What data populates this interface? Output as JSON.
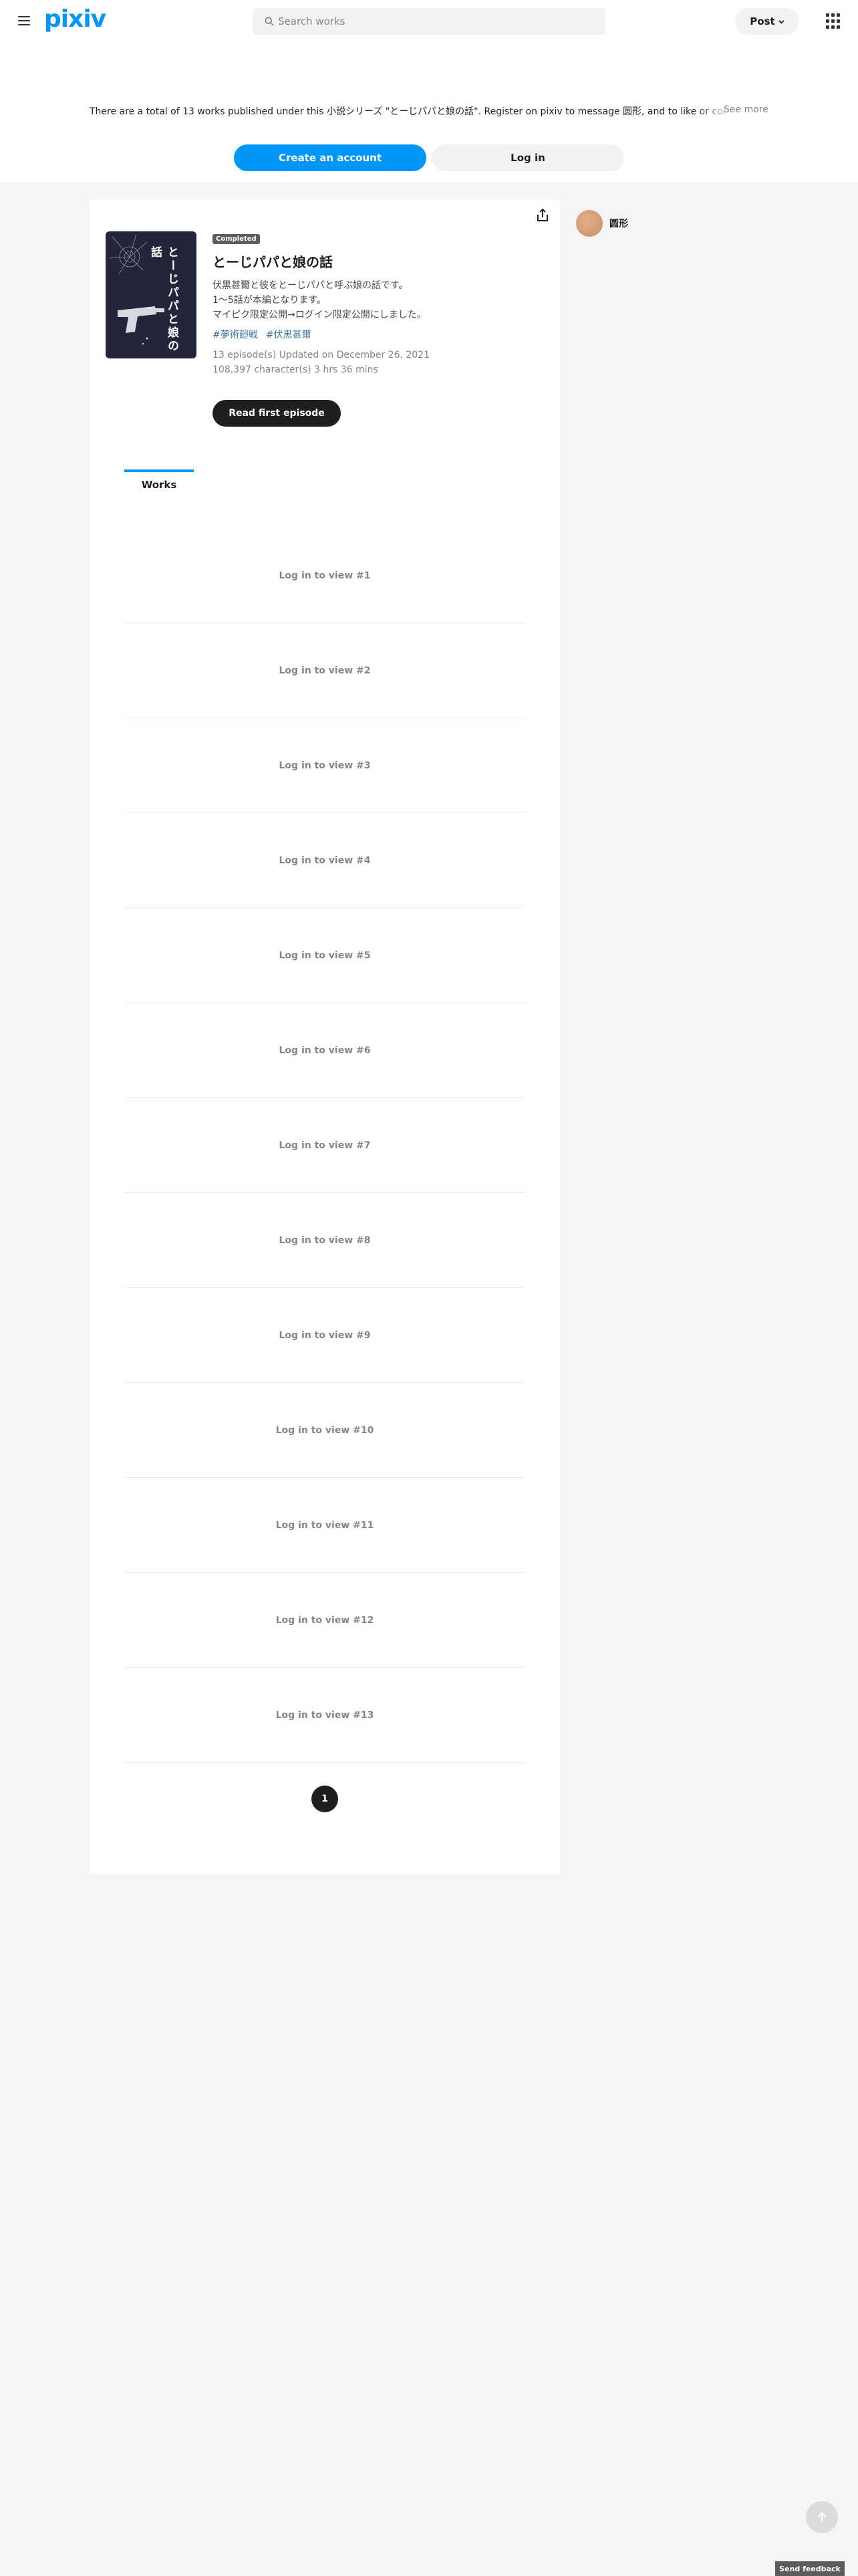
{
  "header": {
    "logo": "pixiv",
    "search_placeholder": "Search works",
    "post_label": "Post",
    "icons": [
      "menu-icon",
      "search-icon",
      "chevron-down-icon",
      "apps-grid-icon"
    ]
  },
  "banner": {
    "text": "There are a total of 13 works published under this 小説シリーズ \"とーじパパと娘の話\". Register on pixiv to message 圆形, and to like or comment on their works.",
    "see_more": "See more",
    "create_account": "Create an account",
    "login": "Log in"
  },
  "series": {
    "cover_title": "とーじパパと娘の話",
    "badge": "Completed",
    "title": "とーじパパと娘の話",
    "caption": [
      "伏黒甚爾と彼をとーじパパと呼ぶ娘の話です。",
      "1〜5話が本編となります。",
      "マイピク限定公開→ログイン限定公開にしました。"
    ],
    "tags": [
      "#夢術廻戦",
      "#伏黒甚爾"
    ],
    "meta_line1": "13 episode(s)  Updated on December 26, 2021",
    "meta_line2": "108,397 character(s)  3 hrs 36 mins",
    "read_first": "Read first episode"
  },
  "tabs": {
    "works": "Works"
  },
  "works": [
    "Log in to view #1",
    "Log in to view #2",
    "Log in to view #3",
    "Log in to view #4",
    "Log in to view #5",
    "Log in to view #6",
    "Log in to view #7",
    "Log in to view #8",
    "Log in to view #9",
    "Log in to view #10",
    "Log in to view #11",
    "Log in to view #12",
    "Log in to view #13"
  ],
  "pagination": {
    "current": "1"
  },
  "author": {
    "name": "圆形"
  },
  "footer": {
    "feedback": "Send feedback"
  },
  "colors": {
    "accent": "#0096fa",
    "dark": "#1f1f1f",
    "tag": "#3d7699",
    "background": "#f5f5f5"
  }
}
